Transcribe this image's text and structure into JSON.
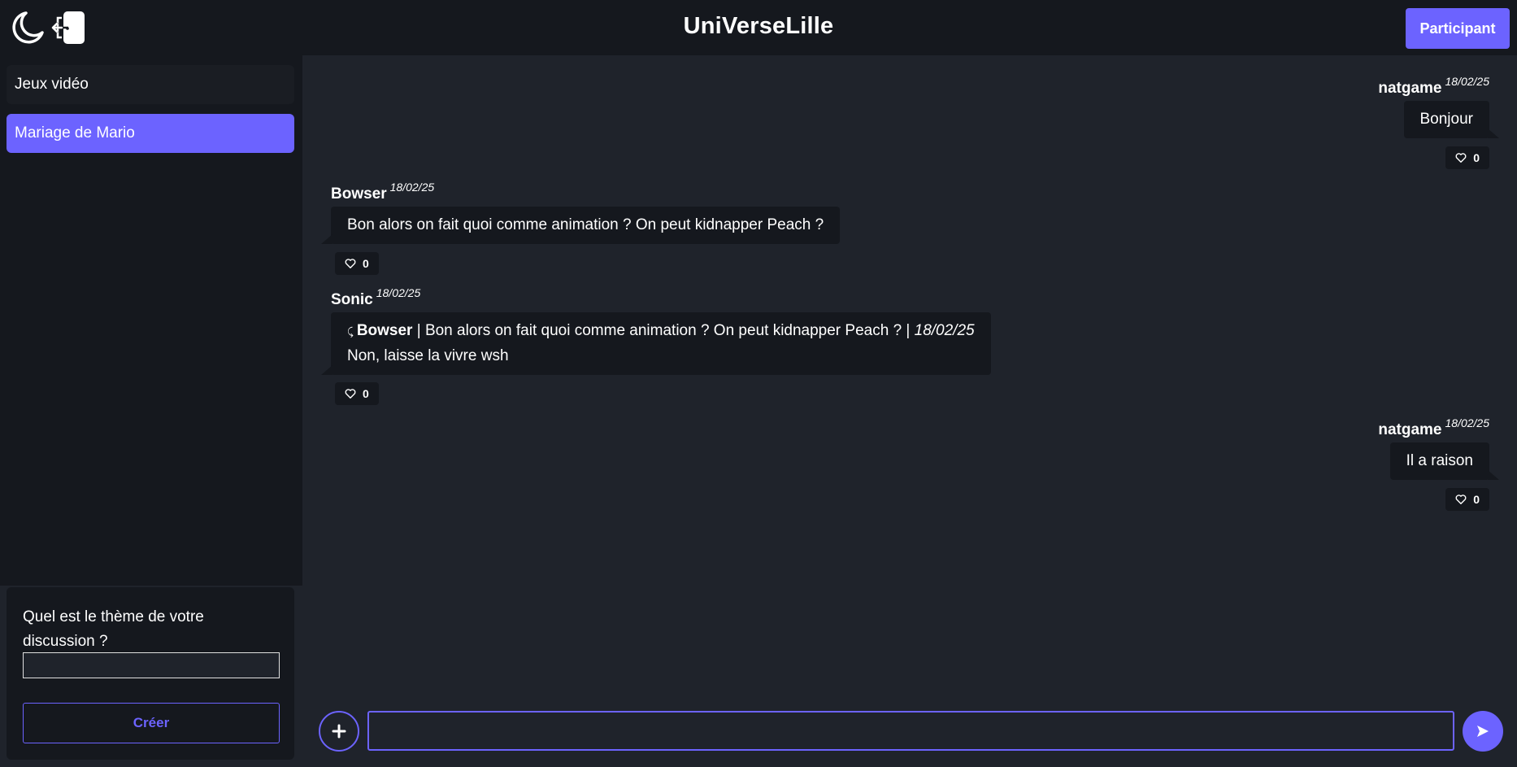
{
  "header": {
    "title": "UniVerseLille",
    "participant_label": "Participant",
    "theme_icon": "moon-icon",
    "logout_icon": "logout-icon"
  },
  "sidebar": {
    "channels": [
      {
        "label": "Jeux vidéo",
        "active": false
      },
      {
        "label": "Mariage de Mario",
        "active": true
      }
    ],
    "create": {
      "question": "Quel est le thème de votre discussion ?",
      "input_value": "",
      "button_label": "Créer"
    }
  },
  "messages": [
    {
      "author": "natgame",
      "date": "18/02/25",
      "text": "Bonjour",
      "likes": "0",
      "side": "right"
    },
    {
      "author": "Bowser",
      "date": "18/02/25",
      "text": "Bon alors on fait quoi comme animation ? On peut kidnapper Peach ?",
      "likes": "0",
      "side": "left"
    },
    {
      "author": "Sonic",
      "date": "18/02/25",
      "reply": {
        "author": "Bowser",
        "text": " | Bon alors on fait quoi comme animation ? On peut kidnapper Peach ? | ",
        "date": "18/02/25"
      },
      "text": "Non, laisse la vivre wsh",
      "likes": "0",
      "side": "left"
    },
    {
      "author": "natgame",
      "date": "18/02/25",
      "text": "Il a raison",
      "likes": "0",
      "side": "right"
    }
  ],
  "composer": {
    "input_value": "",
    "plus_icon": "plus-icon",
    "send_icon": "send-icon"
  },
  "colors": {
    "accent": "#6c63ff",
    "background": "#1f232b",
    "panel": "#15181e"
  }
}
